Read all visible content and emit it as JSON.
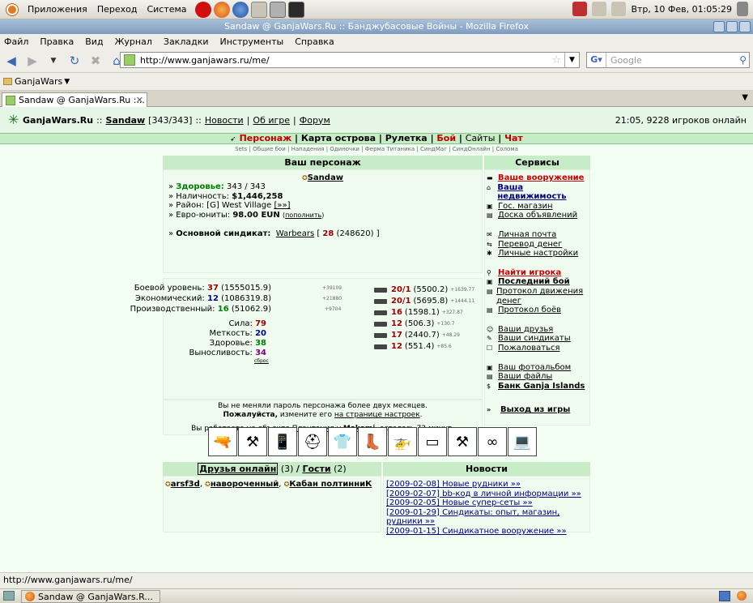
{
  "gnome_panel": {
    "menus": [
      "Приложения",
      "Переход",
      "Система"
    ],
    "clock": "Втр, 10 Фев, 01:05:29"
  },
  "window": {
    "title": "Sandaw @ GanjaWars.Ru :: Банджубасовые Войны - Mozilla Firefox"
  },
  "menubar": [
    "Файл",
    "Правка",
    "Вид",
    "Журнал",
    "Закладки",
    "Инструменты",
    "Справка"
  ],
  "navbar": {
    "url": "http://www.ganjawars.ru/me/",
    "search_placeholder": "Google"
  },
  "bookmarks": {
    "folder": "GanjaWars"
  },
  "tabs": [
    {
      "label": "Sandaw @ GanjaWars.Ru :..."
    }
  ],
  "page": {
    "header": {
      "site": "GanjaWars.Ru",
      "sep1": "::",
      "user": "Sandaw",
      "hp": "[343/343]",
      "sep2": "::",
      "links": [
        "Новости",
        "Об игре",
        "Форум"
      ],
      "online": "21:05, 9228 игроков онлайн"
    },
    "mainnav": [
      "Персонаж",
      "Карта острова",
      "Рулетка",
      "Бой",
      "Сайты",
      "Чат"
    ],
    "subnav": [
      "Sets",
      "Общие бои",
      "Нападения",
      "Одиночки",
      "Ферма Титаника",
      "СиндМаг",
      "СиндОнлайн",
      "Солома"
    ],
    "character": {
      "title": "Ваш персонаж",
      "name": "Sandaw",
      "health_label": "Здоровье:",
      "health": "343 / 343",
      "cash_label": "Наличность:",
      "cash": "$1,446,258",
      "district_label": "Район:",
      "district": "[G] West Village",
      "district_link": "[»»]",
      "euro_label": "Евро-юниты:",
      "euro": "98.00 EUN",
      "euro_link": "пополнить",
      "syndicate_label": "Основной синдикат:",
      "syndicate": "Warbears",
      "syndicate_level": "28",
      "syndicate_points": "(248620)"
    },
    "levels": [
      {
        "label": "Боевой уровень:",
        "value": "37",
        "points": "(1555015.9)",
        "delta": "+39109"
      },
      {
        "label": "Экономический:",
        "value": "12",
        "points": "(1086319.8)",
        "delta": "+21880"
      },
      {
        "label": "Производственный:",
        "value": "16",
        "points": "(51062.9)",
        "delta": "+9704"
      }
    ],
    "attributes": [
      {
        "label": "Сила:",
        "value": "79"
      },
      {
        "label": "Меткость:",
        "value": "20"
      },
      {
        "label": "Здоровье:",
        "value": "38"
      },
      {
        "label": "Выносливость:",
        "value": "34"
      }
    ],
    "reset_link": "сброс",
    "weapons": [
      {
        "level": "20/1",
        "points": "(5500.2)",
        "delta": "+1639.77"
      },
      {
        "level": "20/1",
        "points": "(5695.8)",
        "delta": "+1444.11"
      },
      {
        "level": "16",
        "points": "(1598.1)",
        "delta": "+327.87"
      },
      {
        "level": "12",
        "points": "(506.3)",
        "delta": "+130.7"
      },
      {
        "level": "17",
        "points": "(2440.7)",
        "delta": "+48.29"
      },
      {
        "level": "12",
        "points": "(551.4)",
        "delta": "+85.6"
      }
    ],
    "password_notice": "Вы не меняли пароль персонажа более двух месяцев.",
    "password_please": "Пожалуйста,",
    "password_change": "измените его",
    "password_link": "на странице настроек",
    "work_prefix": "Вы работаете на объекте",
    "work_object": "Плантация",
    "work_at": "у",
    "work_owner": "Makomi",
    "work_suffix": ", осталось 72 минут.",
    "items_icons": [
      "rifle",
      "machine-gun",
      "phone",
      "helmet",
      "suit",
      "boots",
      "helicopter",
      "pda",
      "shovel",
      "binoculars",
      "laptop"
    ],
    "friends": {
      "title_friends": "Друзья онлайн",
      "friends_count": "(3)",
      "sep": "/",
      "title_guests": "Гости",
      "guests_count": "(2)",
      "list": [
        "arsf3d",
        "навороченный",
        "Кабан полтинниК"
      ]
    },
    "news": {
      "title": "Новости",
      "items": [
        "[2009-02-08] Новые рудники »»",
        "[2009-02-07] bb-код в личной информации »»",
        "[2009-02-05] Новые супер-сеты »»",
        "[2009-01-29] Синдикаты: опыт, магазин, рудники »»",
        "[2009-01-15] Синдикатное вооружение »»"
      ]
    },
    "services": {
      "title": "Сервисы",
      "groups": [
        [
          {
            "label": "Ваше вооружение",
            "style": "red",
            "icon": "gun-icon"
          },
          {
            "label": "Ваша недвижимость",
            "style": "bluebold",
            "icon": "house-icon"
          },
          {
            "label": "Гос. магазин",
            "style": "",
            "icon": "shop-icon"
          },
          {
            "label": "Доска объявлений",
            "style": "",
            "icon": "board-icon"
          }
        ],
        [
          {
            "label": "Личная почта",
            "style": "",
            "icon": "mail-icon"
          },
          {
            "label": "Перевод денег",
            "style": "",
            "icon": "money-icon"
          },
          {
            "label": "Личные настройки",
            "style": "",
            "icon": "settings-icon"
          }
        ],
        [
          {
            "label": "Найти игрока",
            "style": "red",
            "icon": "search-icon"
          },
          {
            "label": "Последний бой",
            "style": "bold",
            "icon": "battle-icon"
          },
          {
            "label": "Протокол движения денег",
            "style": "",
            "icon": "log-icon"
          },
          {
            "label": "Протокол боёв",
            "style": "",
            "icon": "log-icon"
          }
        ],
        [
          {
            "label": "Ваши друзья",
            "style": "",
            "icon": "friends-icon"
          },
          {
            "label": "Ваши синдикаты",
            "style": "",
            "icon": "syndicate-icon"
          },
          {
            "label": "Пожаловаться",
            "style": "",
            "icon": "complain-icon"
          }
        ],
        [
          {
            "label": "Ваш фотоальбом",
            "style": "",
            "icon": "photo-icon"
          },
          {
            "label": "Ваши файлы",
            "style": "",
            "icon": "file-icon"
          },
          {
            "label": "Банк Ganja Islands",
            "style": "bold",
            "icon": "dollar-icon"
          }
        ]
      ],
      "exit": "Выход из игры"
    }
  },
  "statusbar": "http://www.ganjawars.ru/me/",
  "taskbar": {
    "task": "Sandaw @ GanjaWars.R..."
  }
}
